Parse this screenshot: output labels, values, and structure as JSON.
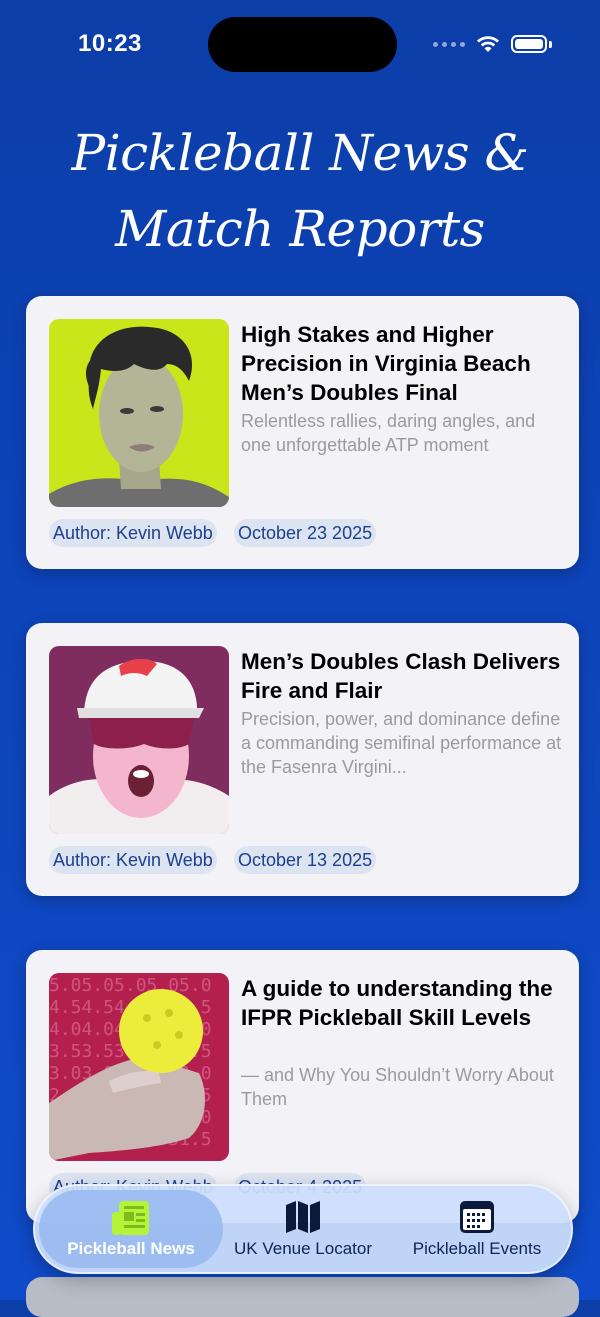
{
  "status_bar": {
    "time": "10:23"
  },
  "page": {
    "title_line1": "Pickleball News &",
    "title_line2": "Match Reports"
  },
  "articles": [
    {
      "title": "High Stakes and Higher Precision in Virginia Beach Men’s Doubles Final",
      "subtitle": "Relentless rallies, daring angles, and one unforgettable ATP moment",
      "author": "Author: Kevin Webb",
      "date": "October 23 2025"
    },
    {
      "title": "Men’s Doubles Clash Delivers Fire and Flair",
      "subtitle": "Precision, power, and dominance define a commanding semifinal performance at the Fasenra Virgini...",
      "author": "Author: Kevin Webb",
      "date": "October 13 2025"
    },
    {
      "title": "A guide to understanding the IFPR Pickleball Skill Levels",
      "subtitle": "— and Why You Shouldn’t Worry About Them",
      "author": "Author: Kevin Webb",
      "date": "October 4 2025"
    }
  ],
  "tabbar": {
    "items": [
      {
        "label": "Pickleball News",
        "icon": "newspaper-icon",
        "active": true
      },
      {
        "label": "UK Venue Locator",
        "icon": "map-icon",
        "active": false
      },
      {
        "label": "Pickleball Events",
        "icon": "calendar-icon",
        "active": false
      }
    ],
    "active_color": "#b5f23a"
  }
}
